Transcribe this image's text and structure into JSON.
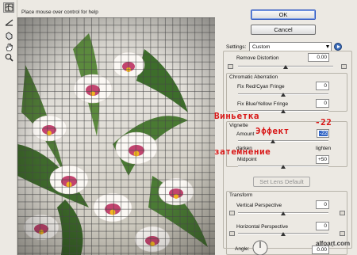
{
  "hint": "Place mouse over control for help",
  "tools": [
    {
      "name": "remove-distortion-tool-icon",
      "active": true
    },
    {
      "name": "straighten-tool-icon",
      "active": false
    },
    {
      "name": "move-grid-tool-icon",
      "active": false
    },
    {
      "name": "hand-tool-icon",
      "active": false
    },
    {
      "name": "zoom-tool-icon",
      "active": false
    }
  ],
  "buttons": {
    "ok": "OK",
    "cancel": "Cancel",
    "set_lens_default": "Set Lens Default"
  },
  "settings": {
    "label": "Settings:",
    "value": "Custom"
  },
  "remove_distortion": {
    "label": "Remove Distortion",
    "value": "0.00"
  },
  "chromatic": {
    "title": "Chromatic Aberration",
    "red_cyan": {
      "label": "Fix Red/Cyan Fringe",
      "value": "0"
    },
    "blue_yellow": {
      "label": "Fix Blue/Yellow Fringe",
      "value": "0"
    }
  },
  "vignette": {
    "title": "Vignette",
    "amount": {
      "label": "Amount",
      "value": "-22",
      "fraction": 0.39
    },
    "darken": "darken",
    "lighten": "lighten",
    "midpoint": {
      "label": "Midpoint",
      "value": "+50",
      "fraction": 0.5
    }
  },
  "transform": {
    "title": "Transform",
    "vertical": {
      "label": "Vertical Perspective",
      "value": "0"
    },
    "horizontal": {
      "label": "Horizontal Perspective",
      "value": "0"
    },
    "angle": {
      "label": "Angle:",
      "value": "0.00",
      "unit": "°"
    }
  },
  "annotations": {
    "vignette_ru": "Виньетка",
    "effect_ru": "Эффект",
    "effect_value": "-22",
    "darkening_ru": "затемнение"
  },
  "watermark": "alfoart.com",
  "colors": {
    "panel_bg": "#ece9e3",
    "annotation_red": "#d81313",
    "selection_blue": "#3165c5",
    "default_button_border": "#2a52be"
  }
}
